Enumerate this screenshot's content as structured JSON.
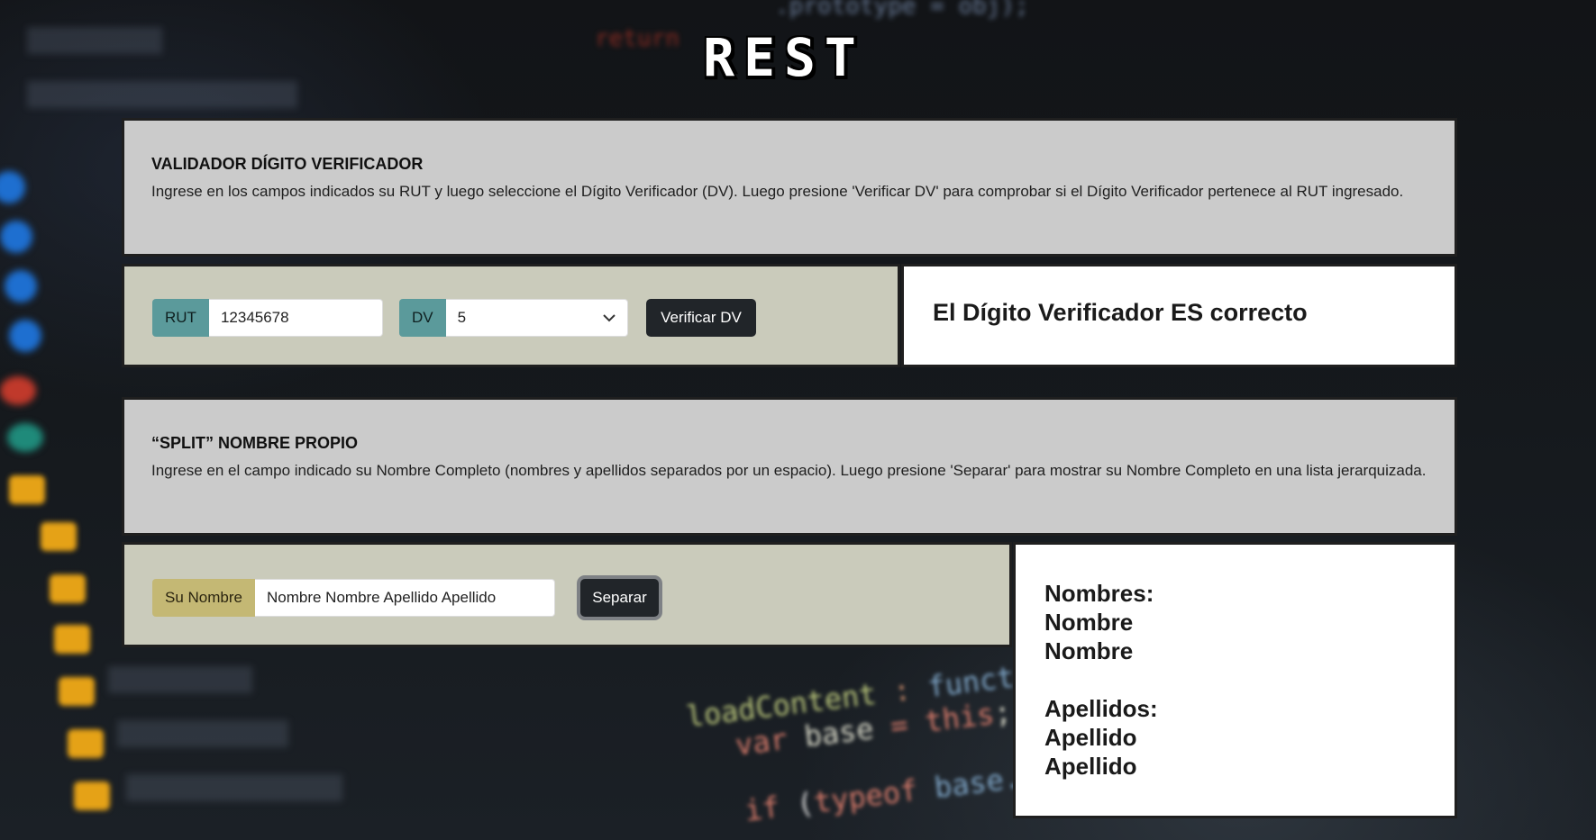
{
  "logo": {
    "text": "REST"
  },
  "dv_section": {
    "title": "VALIDADOR DÍGITO VERIFICADOR",
    "description": "Ingrese en los campos indicados su RUT y luego seleccione el Dígito Verificador (DV). Luego presione 'Verificar DV' para comprobar si el Dígito Verificador pertenece al RUT ingresado.",
    "rut_label": "RUT",
    "rut_value": "12345678",
    "dv_label": "DV",
    "dv_selected": "5",
    "button_label": "Verificar DV",
    "result": "El Dígito Verificador ES correcto"
  },
  "split_section": {
    "title": "“SPLIT” NOMBRE PROPIO",
    "description": "Ingrese en el campo indicado su Nombre Completo (nombres y apellidos separados por un espacio). Luego presione 'Separar' para mostrar su Nombre Completo en una lista jerarquizada.",
    "name_label": "Su Nombre",
    "name_value": "Nombre Nombre Apellido Apellido",
    "button_label": "Separar",
    "result": {
      "names_heading": "Nombres:",
      "names": [
        "Nombre",
        "Nombre"
      ],
      "surnames_heading": "Apellidos:",
      "surnames": [
        "Apellido",
        "Apellido"
      ]
    }
  },
  "colors": {
    "info_panel": "#cbcbcb",
    "form_panel": "#cacbbb",
    "rut_addon": "#5b9a9b",
    "name_addon": "#c4b874",
    "button": "#212529"
  },
  "icons": {
    "select_arrow": "chevron-down-icon"
  }
}
